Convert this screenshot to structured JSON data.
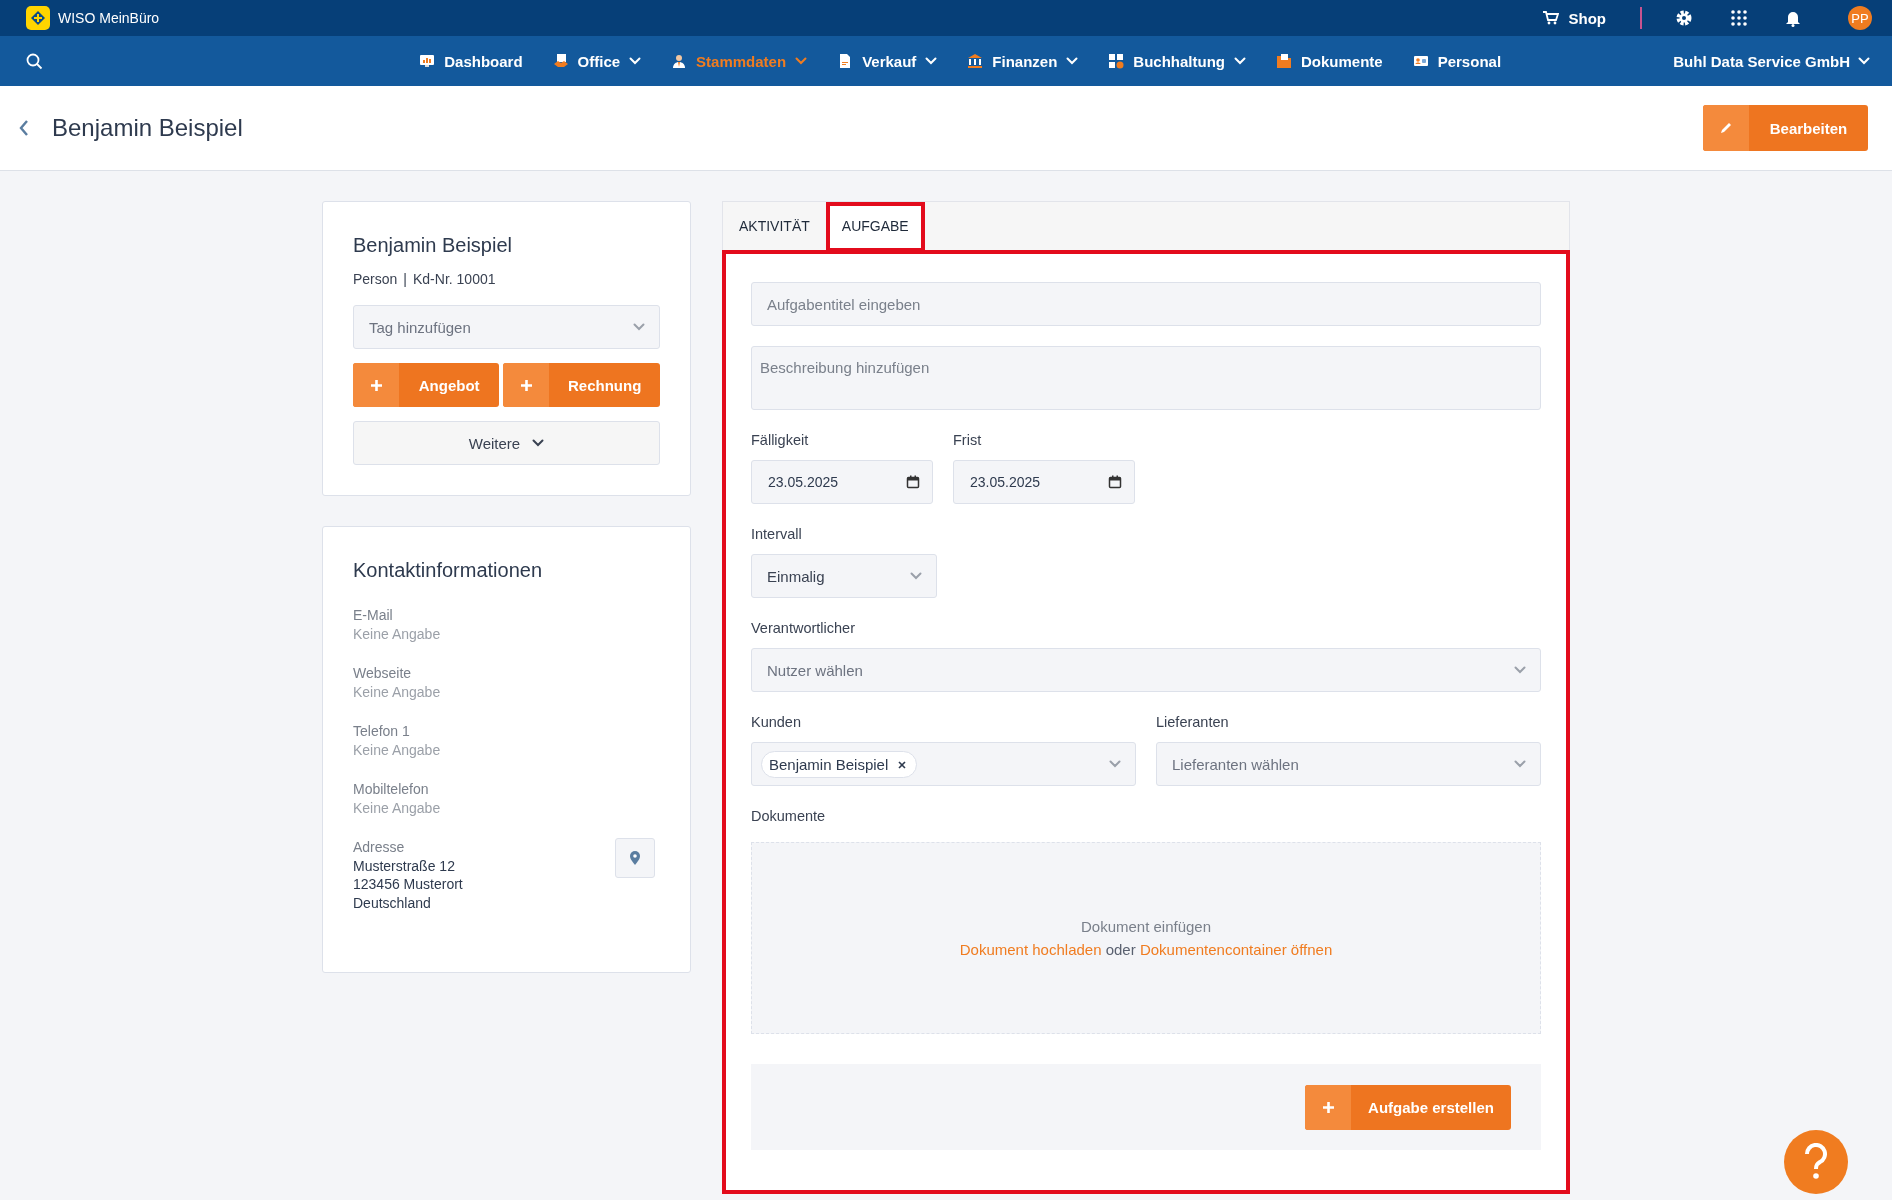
{
  "app": {
    "name": "WISO MeinBüro",
    "shop": "Shop",
    "avatar": "PP"
  },
  "nav": {
    "items": [
      {
        "label": "Dashboard",
        "dropdown": false,
        "selected": false
      },
      {
        "label": "Office",
        "dropdown": true,
        "selected": false
      },
      {
        "label": "Stammdaten",
        "dropdown": true,
        "selected": true
      },
      {
        "label": "Verkauf",
        "dropdown": true,
        "selected": false
      },
      {
        "label": "Finanzen",
        "dropdown": true,
        "selected": false
      },
      {
        "label": "Buchhaltung",
        "dropdown": true,
        "selected": false
      },
      {
        "label": "Dokumente",
        "dropdown": false,
        "selected": false
      },
      {
        "label": "Personal",
        "dropdown": false,
        "selected": false
      }
    ],
    "company": "Buhl Data Service GmbH"
  },
  "header": {
    "title": "Benjamin Beispiel",
    "edit_button": "Bearbeiten"
  },
  "customer_card": {
    "name": "Benjamin Beispiel",
    "type": "Person",
    "separator": "|",
    "number": "Kd-Nr. 10001",
    "tag_placeholder": "Tag hinzufügen",
    "buttons": [
      "Angebot",
      "Rechnung"
    ],
    "more": "Weitere"
  },
  "contact": {
    "title": "Kontaktinformationen",
    "fields": [
      {
        "label": "E-Mail",
        "value": "Keine Angabe"
      },
      {
        "label": "Webseite",
        "value": "Keine Angabe"
      },
      {
        "label": "Telefon 1",
        "value": "Keine Angabe"
      },
      {
        "label": "Mobiltelefon",
        "value": "Keine Angabe"
      }
    ],
    "address": {
      "label": "Adresse",
      "lines": [
        "Musterstraße 12",
        "123456 Musterort",
        "Deutschland"
      ]
    }
  },
  "tabs": [
    {
      "label": "AKTIVITÄT",
      "selected": false,
      "highlighted": false
    },
    {
      "label": "AUFGABE",
      "selected": true,
      "highlighted": true
    }
  ],
  "form": {
    "highlighted": true,
    "title_placeholder": "Aufgabentitel eingeben",
    "description_placeholder": "Beschreibung hinzufügen",
    "due": {
      "label": "Fälligkeit",
      "value": "23.05.2025"
    },
    "deadline": {
      "label": "Frist",
      "value": "23.05.2025"
    },
    "interval": {
      "label": "Intervall",
      "value": "Einmalig"
    },
    "responsible": {
      "label": "Verantwortlicher",
      "placeholder": "Nutzer wählen"
    },
    "customers": {
      "label": "Kunden",
      "chips": [
        "Benjamin Beispiel"
      ]
    },
    "suppliers": {
      "label": "Lieferanten",
      "placeholder": "Lieferanten wählen"
    },
    "documents": {
      "label": "Dokumente",
      "hint": "Dokument einfügen",
      "upload_link": "Dokument hochladen",
      "separator": "oder",
      "container_link": "Dokumentencontainer öffnen"
    },
    "submit": "Aufgabe erstellen"
  }
}
